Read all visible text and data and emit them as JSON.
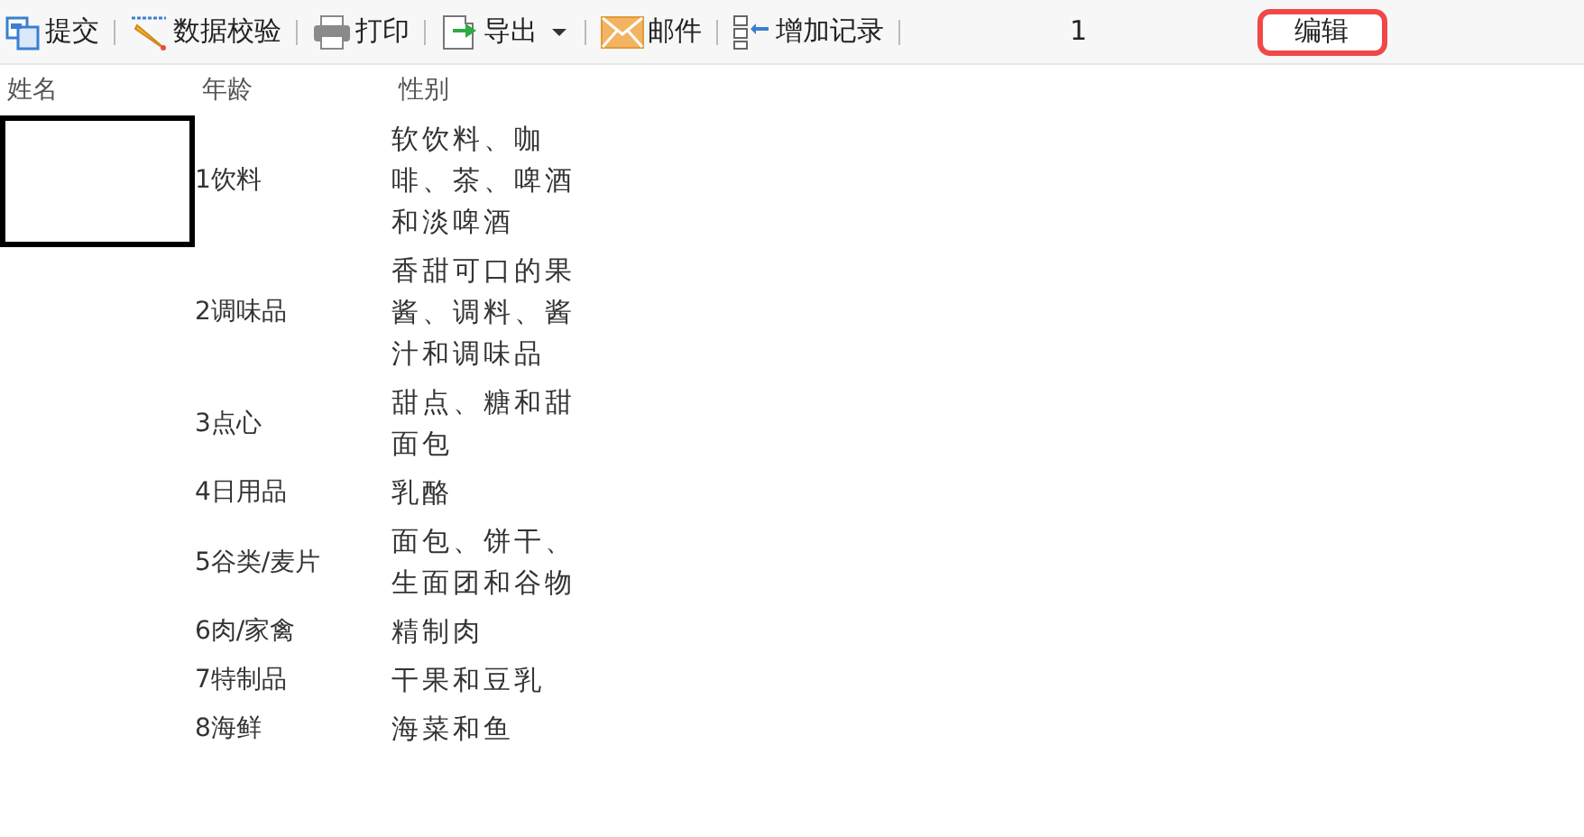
{
  "toolbar": {
    "items": [
      {
        "kind": "submit",
        "label": "提交"
      },
      {
        "kind": "validate",
        "label": "数据校验"
      },
      {
        "kind": "print",
        "label": "打印"
      },
      {
        "kind": "export",
        "label": "导出"
      },
      {
        "kind": "mail",
        "label": "邮件"
      },
      {
        "kind": "add",
        "label": "增加记录"
      }
    ],
    "page": "1",
    "edit_button": "编辑"
  },
  "table": {
    "columns": [
      "姓名",
      "年龄",
      "性别"
    ],
    "rows": [
      {
        "selected": true,
        "column_2": "1饮料",
        "column_3": "软饮料、咖啡、茶、啤酒和淡啤酒"
      },
      {
        "selected": false,
        "column_2": "2调味品",
        "column_3": "香甜可口的果酱、调料、酱汁和调味品"
      },
      {
        "selected": false,
        "column_2": "3点心",
        "column_3": "甜点、糖和甜面包"
      },
      {
        "selected": false,
        "column_2": "4日用品",
        "column_3": "乳酪"
      },
      {
        "selected": false,
        "column_2": "5谷类/麦片",
        "column_3": "面包、饼干、生面团和谷物"
      },
      {
        "selected": false,
        "column_2": "6肉/家禽",
        "column_3": "精制肉"
      },
      {
        "selected": false,
        "column_2": "7特制品",
        "column_3": "干果和豆乳"
      },
      {
        "selected": false,
        "column_2": "8海鲜",
        "column_3": "海菜和鱼"
      }
    ]
  }
}
